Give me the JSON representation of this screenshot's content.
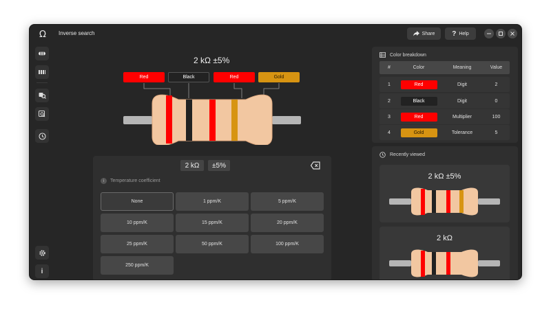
{
  "window": {
    "title": "Inverse search"
  },
  "toolbar": {
    "share_label": "Share",
    "help_label": "Help"
  },
  "colors": {
    "red": "#ff0000",
    "black": "#222222",
    "gold": "#d79412",
    "body": "#f2c7a1",
    "lead": "#b5b5b5",
    "panel": "#2f2f2f"
  },
  "resistor": {
    "value_text": "2 kΩ  ±5%",
    "bands": [
      {
        "label": "Red",
        "color": "#ff0000"
      },
      {
        "label": "Black",
        "color": "#222222"
      },
      {
        "label": "Red",
        "color": "#ff0000"
      },
      {
        "label": "Gold",
        "color": "#d79412"
      }
    ]
  },
  "temp_panel": {
    "resistance_chip": "2 kΩ",
    "tolerance_chip": "±5%",
    "label": "Temperature coefficient",
    "options": [
      "None",
      "1 ppm/K",
      "5 ppm/K",
      "10 ppm/K",
      "15 ppm/K",
      "20 ppm/K",
      "25 ppm/K",
      "50 ppm/K",
      "100 ppm/K",
      "250 ppm/K"
    ],
    "selected": "None"
  },
  "color_breakdown": {
    "title": "Color breakdown",
    "headers": [
      "#",
      "Color",
      "Meaning",
      "Value"
    ],
    "rows": [
      {
        "num": "1",
        "color": "Red",
        "meaning": "Digit",
        "value": "2"
      },
      {
        "num": "2",
        "color": "Black",
        "meaning": "Digit",
        "value": "0"
      },
      {
        "num": "3",
        "color": "Red",
        "meaning": "Multiplier",
        "value": "100"
      },
      {
        "num": "4",
        "color": "Gold",
        "meaning": "Tolerance",
        "value": "5"
      }
    ]
  },
  "recently_viewed": {
    "title": "Recently viewed",
    "items": [
      {
        "label": "2 kΩ  ±5%"
      },
      {
        "label": "2 kΩ"
      }
    ]
  },
  "sidebar": {
    "items": [
      "resistor-4band-icon",
      "resistor-5band-icon",
      "search-icon",
      "inverse-search-icon",
      "history-icon"
    ],
    "bottom": [
      "settings-icon",
      "info-icon"
    ]
  }
}
